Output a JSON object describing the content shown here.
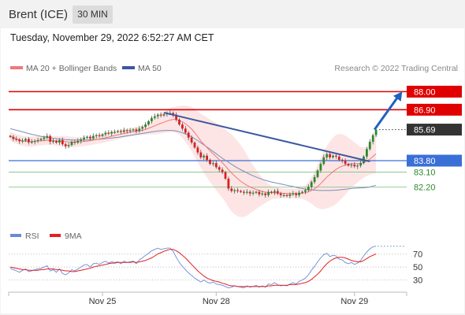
{
  "header": {
    "instrument": "Brent (ICE)",
    "timeframe": "30 MIN",
    "datetime": "Tuesday, November 29, 2022 6:52:27 AM CET"
  },
  "legend": {
    "ma20_label": "MA 20 + Bollinger Bands",
    "ma50_label": "MA 50",
    "credit": "Research © 2022 Trading Central"
  },
  "rsi_legend": {
    "rsi_label": "RSI",
    "ma9_label": "9MA"
  },
  "colors": {
    "resistance": "#e00000",
    "support_blue": "#3a6fd8",
    "support_green": "#2a8a2a",
    "current": "#333333",
    "ma20": "#f07878",
    "ma50": "#7b8db8",
    "band_fill": "#fde2e2",
    "candle_up": "#2a8a2a",
    "candle_down": "#d82020",
    "trendline": "#3b58a0",
    "arrow": "#2060c0",
    "rsi": "#6a8ad8",
    "rsi_ma": "#e02020"
  },
  "chart_data": [
    {
      "type": "candlestick",
      "title": "Brent (ICE) 30 MIN",
      "x_ticks": [
        "Nov 25",
        "Nov 28",
        "Nov 29"
      ],
      "ylim": [
        81.45,
        88.45
      ],
      "levels": [
        {
          "value": 88.0,
          "label": "88.00",
          "kind": "resistance"
        },
        {
          "value": 86.9,
          "label": "86.90",
          "kind": "resistance"
        },
        {
          "value": 85.69,
          "label": "85.69",
          "kind": "current"
        },
        {
          "value": 83.8,
          "label": "83.80",
          "kind": "support"
        },
        {
          "value": 83.1,
          "label": "83.10",
          "kind": "support-minor"
        },
        {
          "value": 82.2,
          "label": "82.20",
          "kind": "support-minor"
        }
      ],
      "closes": [
        85.25,
        85.12,
        85.08,
        84.98,
        85.02,
        85.12,
        84.92,
        84.95,
        85.0,
        85.05,
        85.12,
        85.2,
        85.3,
        84.95,
        85.0,
        84.9,
        85.05,
        84.8,
        84.68,
        84.75,
        84.95,
        84.9,
        85.0,
        85.1,
        85.2,
        85.25,
        85.15,
        85.3,
        85.35,
        85.3,
        85.4,
        85.5,
        85.45,
        85.55,
        85.55,
        85.6,
        85.55,
        85.65,
        85.6,
        85.65,
        85.7,
        85.6,
        85.75,
        85.85,
        86.0,
        86.2,
        86.4,
        86.5,
        86.6,
        86.55,
        86.62,
        86.68,
        86.7,
        86.6,
        86.3,
        86.0,
        85.75,
        85.5,
        85.2,
        84.9,
        84.6,
        84.3,
        84.0,
        84.1,
        83.85,
        83.6,
        83.65,
        83.4,
        83.25,
        83.1,
        82.7,
        82.1,
        81.95,
        82.0,
        81.95,
        81.9,
        81.85,
        81.9,
        81.8,
        81.85,
        81.9,
        81.75,
        81.8,
        81.7,
        81.9,
        81.85,
        81.95,
        81.8,
        81.7,
        81.7,
        81.65,
        81.75,
        81.8,
        81.7,
        81.85,
        81.9,
        82.0,
        82.2,
        82.5,
        82.8,
        83.2,
        83.6,
        84.0,
        84.2,
        84.0,
        84.1,
        84.05,
        83.85,
        83.8,
        83.6,
        83.5,
        83.55,
        83.45,
        83.5,
        83.65,
        84.05,
        84.5,
        84.95,
        85.35,
        85.69
      ],
      "ma20": [
        85.3,
        85.2,
        85.12,
        85.06,
        85.01,
        84.98,
        84.95,
        84.96,
        84.98,
        85.0,
        85.01,
        85.03,
        85.04,
        85.03,
        85.02,
        85.0,
        84.99,
        84.98,
        84.96,
        84.94,
        84.93,
        84.93,
        84.94,
        84.95,
        84.97,
        84.99,
        85.02,
        85.05,
        85.08,
        85.12,
        85.15,
        85.19,
        85.24,
        85.29,
        85.33,
        85.37,
        85.41,
        85.45,
        85.49,
        85.53,
        85.56,
        85.58,
        85.61,
        85.65,
        85.7,
        85.77,
        85.84,
        85.92,
        86.0,
        86.07,
        86.14,
        86.21,
        86.27,
        86.3,
        86.3,
        86.25,
        86.17,
        86.05,
        85.9,
        85.72,
        85.5,
        85.26,
        85.0,
        84.8,
        84.6,
        84.4,
        84.22,
        84.04,
        83.86,
        83.68,
        83.48,
        83.25,
        83.05,
        82.87,
        82.7,
        82.55,
        82.42,
        82.3,
        82.2,
        82.12,
        82.05,
        81.98,
        81.93,
        81.88,
        81.86,
        81.85,
        81.84,
        81.83,
        81.82,
        81.81,
        81.8,
        81.8,
        81.8,
        81.8,
        81.8,
        81.82,
        81.85,
        81.9,
        81.98,
        82.08,
        82.22,
        82.4,
        82.6,
        82.8,
        82.96,
        83.12,
        83.26,
        83.38,
        83.47,
        83.53,
        83.58,
        83.61,
        83.62,
        83.62,
        83.63,
        83.68,
        83.77,
        83.9,
        84.05,
        84.22
      ],
      "bb_width": [
        0.28,
        0.28,
        0.29,
        0.3,
        0.3,
        0.31,
        0.31,
        0.31,
        0.3,
        0.29,
        0.28,
        0.28,
        0.27,
        0.27,
        0.28,
        0.3,
        0.3,
        0.33,
        0.35,
        0.34,
        0.32,
        0.3,
        0.29,
        0.28,
        0.28,
        0.28,
        0.27,
        0.27,
        0.27,
        0.27,
        0.27,
        0.28,
        0.28,
        0.28,
        0.27,
        0.26,
        0.26,
        0.25,
        0.25,
        0.25,
        0.25,
        0.25,
        0.26,
        0.28,
        0.32,
        0.38,
        0.45,
        0.52,
        0.58,
        0.62,
        0.66,
        0.7,
        0.73,
        0.76,
        0.8,
        0.88,
        0.98,
        1.1,
        1.22,
        1.34,
        1.45,
        1.55,
        1.65,
        1.75,
        1.82,
        1.9,
        1.98,
        2.05,
        2.1,
        2.15,
        2.2,
        2.3,
        2.35,
        2.33,
        2.28,
        2.2,
        2.05,
        1.85,
        1.62,
        1.4,
        1.2,
        1.0,
        0.82,
        0.66,
        0.52,
        0.42,
        0.36,
        0.32,
        0.3,
        0.3,
        0.3,
        0.3,
        0.3,
        0.3,
        0.32,
        0.36,
        0.45,
        0.6,
        0.8,
        1.05,
        1.3,
        1.55,
        1.75,
        1.9,
        2.0,
        2.08,
        2.1,
        2.05,
        1.95,
        1.8,
        1.62,
        1.45,
        1.3,
        1.15,
        1.0,
        0.92,
        0.9,
        0.95,
        1.05,
        1.2
      ],
      "ma50": [
        85.75,
        85.7,
        85.65,
        85.6,
        85.55,
        85.5,
        85.45,
        85.4,
        85.36,
        85.32,
        85.28,
        85.25,
        85.22,
        85.19,
        85.16,
        85.14,
        85.12,
        85.1,
        85.08,
        85.07,
        85.06,
        85.05,
        85.05,
        85.05,
        85.05,
        85.06,
        85.07,
        85.08,
        85.09,
        85.1,
        85.12,
        85.14,
        85.16,
        85.18,
        85.2,
        85.22,
        85.25,
        85.28,
        85.31,
        85.34,
        85.37,
        85.4,
        85.43,
        85.46,
        85.49,
        85.52,
        85.55,
        85.58,
        85.6,
        85.62,
        85.63,
        85.64,
        85.64,
        85.63,
        85.6,
        85.56,
        85.5,
        85.43,
        85.35,
        85.25,
        85.14,
        85.02,
        84.89,
        84.76,
        84.63,
        84.5,
        84.36,
        84.22,
        84.08,
        83.95,
        83.82,
        83.7,
        83.58,
        83.46,
        83.35,
        83.25,
        83.15,
        83.05,
        82.96,
        82.88,
        82.8,
        82.73,
        82.66,
        82.6,
        82.55,
        82.5,
        82.46,
        82.42,
        82.38,
        82.34,
        82.3,
        82.26,
        82.22,
        82.18,
        82.14,
        82.1,
        82.07,
        82.04,
        82.02,
        82.0,
        81.99,
        81.98,
        81.98,
        81.98,
        81.98,
        81.99,
        82.0,
        82.02,
        82.04,
        82.06,
        82.08,
        82.1,
        82.12,
        82.13,
        82.14,
        82.15,
        82.17,
        82.2,
        82.25,
        82.3
      ],
      "trendline": {
        "from_index": 50,
        "from_value": 86.72,
        "to_index": 117,
        "to_value": 83.75
      },
      "arrow": {
        "from_index": 118,
        "from_value": 85.69,
        "to_index": 127,
        "to_value": 88.0
      }
    },
    {
      "type": "line",
      "title": "RSI",
      "series": [
        {
          "name": "RSI"
        },
        {
          "name": "9MA"
        }
      ],
      "ylim": [
        15,
        90
      ],
      "y_ticks": [
        70,
        50,
        30
      ],
      "rsi": [
        48,
        46,
        44,
        42,
        45,
        47,
        43,
        44,
        46,
        47,
        48,
        50,
        52,
        44,
        46,
        42,
        47,
        40,
        38,
        41,
        46,
        44,
        47,
        50,
        53,
        54,
        50,
        55,
        56,
        54,
        57,
        59,
        56,
        58,
        57,
        58,
        55,
        59,
        57,
        58,
        59,
        55,
        61,
        64,
        68,
        71,
        75,
        77,
        79,
        77,
        78,
        79,
        79,
        74,
        65,
        57,
        51,
        46,
        41,
        37,
        33,
        30,
        27,
        30,
        27,
        25,
        27,
        24,
        23,
        22,
        20,
        18,
        19,
        21,
        20,
        19,
        18,
        21,
        19,
        20,
        22,
        19,
        21,
        19,
        24,
        23,
        26,
        23,
        21,
        22,
        21,
        24,
        26,
        24,
        28,
        30,
        33,
        38,
        45,
        51,
        58,
        64,
        69,
        71,
        66,
        68,
        67,
        62,
        61,
        57,
        55,
        57,
        54,
        56,
        60,
        67,
        73,
        78,
        81,
        82
      ],
      "rsi_ma": [
        50,
        49,
        48,
        47,
        46,
        46,
        45,
        45,
        45,
        45,
        46,
        46,
        47,
        47,
        47,
        46,
        46,
        45,
        44,
        44,
        43,
        43,
        44,
        45,
        46,
        47,
        48,
        50,
        51,
        52,
        53,
        54,
        55,
        56,
        56,
        57,
        57,
        57,
        57,
        57,
        58,
        57,
        58,
        59,
        60,
        62,
        64,
        67,
        70,
        72,
        74,
        76,
        77,
        77,
        75,
        72,
        68,
        64,
        59,
        54,
        49,
        44,
        40,
        36,
        33,
        31,
        29,
        28,
        27,
        25,
        24,
        22,
        21,
        21,
        20,
        20,
        20,
        20,
        20,
        20,
        20,
        20,
        20,
        20,
        21,
        21,
        22,
        22,
        22,
        22,
        22,
        23,
        23,
        23,
        24,
        25,
        26,
        28,
        31,
        35,
        39,
        44,
        50,
        55,
        59,
        62,
        64,
        65,
        65,
        64,
        62,
        60,
        59,
        58,
        58,
        60,
        63,
        66,
        68,
        70
      ]
    }
  ]
}
